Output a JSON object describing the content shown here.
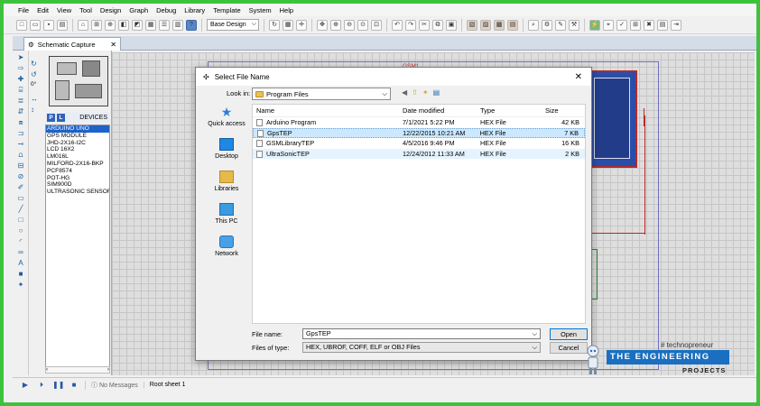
{
  "menu": [
    "File",
    "Edit",
    "View",
    "Tool",
    "Design",
    "Graph",
    "Debug",
    "Library",
    "Template",
    "System",
    "Help"
  ],
  "toolbar": {
    "design_select": "Base Design"
  },
  "tab": {
    "label": "Schematic Capture"
  },
  "sidebar": {
    "p_label": "P",
    "l_label": "L",
    "devices_label": "DEVICES",
    "devices": [
      "ARDUINO UNO",
      "GPS MODULE",
      "JHD-2X16-I2C",
      "LCD 16X2",
      "LM016L",
      "MILFORD-2X16-BKP",
      "PCF8574",
      "POT-HG",
      "SIM900D",
      "ULTRASONIC SENSOR"
    ],
    "rotation": "0°"
  },
  "schematic": {
    "label": "GSM1"
  },
  "status": {
    "messages": "No Messages",
    "sheet": "Root sheet 1"
  },
  "dialog": {
    "title": "Select File Name",
    "look_in_label": "Look in:",
    "look_in_value": "Program Files",
    "places": [
      "Quick access",
      "Desktop",
      "Libraries",
      "This PC",
      "Network"
    ],
    "columns": {
      "name": "Name",
      "date": "Date modified",
      "type": "Type",
      "size": "Size"
    },
    "files": [
      {
        "name": "Arduino Program",
        "date": "7/1/2021 5:22 PM",
        "type": "HEX File",
        "size": "42 KB"
      },
      {
        "name": "GpsTEP",
        "date": "12/22/2015 10:21 AM",
        "type": "HEX File",
        "size": "7 KB"
      },
      {
        "name": "GSMLibraryTEP",
        "date": "4/5/2016 9:46 PM",
        "type": "HEX File",
        "size": "16 KB"
      },
      {
        "name": "UltraSonicTEP",
        "date": "12/24/2012 11:33 AM",
        "type": "HEX File",
        "size": "2 KB"
      }
    ],
    "file_name_label": "File name:",
    "file_name_value": "GpsTEP",
    "file_type_label": "Files of type:",
    "file_type_value": "HEX, UBROF, COFF, ELF or OBJ Files",
    "open_label": "Open",
    "cancel_label": "Cancel"
  },
  "watermark": {
    "hashtag": "# technopreneur",
    "main": "THE ENGINEERING",
    "sub": "PROJECTS"
  }
}
